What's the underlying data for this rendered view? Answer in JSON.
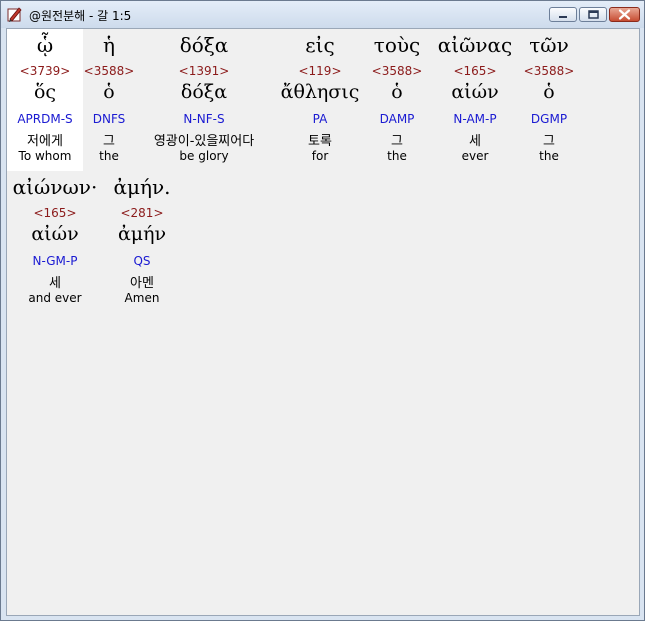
{
  "window": {
    "title": "@원전분해 - 갈 1:5",
    "app_icon": "pen-document-icon",
    "controls": {
      "minimize": "minimize-icon",
      "maximize": "maximize-icon",
      "close": "close-icon"
    }
  },
  "colors": {
    "strongs": "#8b1a1a",
    "parsing": "#1a1ad2",
    "selection": "#ffffff"
  },
  "words": [
    {
      "greek": "ᾧ",
      "strongs": "<3739>",
      "lemma": "ὅς",
      "parsing": "APRDM-S",
      "korean": "저에게",
      "english": "To whom",
      "selected": true
    },
    {
      "greek": "ἡ",
      "strongs": "<3588>",
      "lemma": "ὁ",
      "parsing": "DNFS",
      "korean": "그",
      "english": "the",
      "selected": false
    },
    {
      "greek": "δόξα",
      "strongs": "<1391>",
      "lemma": "δόξα",
      "parsing": "N-NF-S",
      "korean": "영광이-있을찌어다",
      "english": "be glory",
      "selected": false
    },
    {
      "greek": "εἰς",
      "strongs": "<119>",
      "lemma": "ἄθλησις",
      "parsing": "PA",
      "korean": "토록",
      "english": "for",
      "selected": false
    },
    {
      "greek": "τοὺς",
      "strongs": "<3588>",
      "lemma": "ὁ",
      "parsing": "DAMP",
      "korean": "그",
      "english": "the",
      "selected": false
    },
    {
      "greek": "αἰῶνας",
      "strongs": "<165>",
      "lemma": "αἰών",
      "parsing": "N-AM-P",
      "korean": "세",
      "english": "ever",
      "selected": false
    },
    {
      "greek": "τῶν",
      "strongs": "<3588>",
      "lemma": "ὁ",
      "parsing": "DGMP",
      "korean": "그",
      "english": "the",
      "selected": false
    },
    {
      "greek": "αἰώνων·",
      "strongs": "<165>",
      "lemma": "αἰών",
      "parsing": "N-GM-P",
      "korean": "세",
      "english": "and ever",
      "selected": false
    },
    {
      "greek": "ἀμήν.",
      "strongs": "<281>",
      "lemma": "ἀμήν",
      "parsing": "QS",
      "korean": "아멘",
      "english": "Amen",
      "selected": false
    }
  ]
}
